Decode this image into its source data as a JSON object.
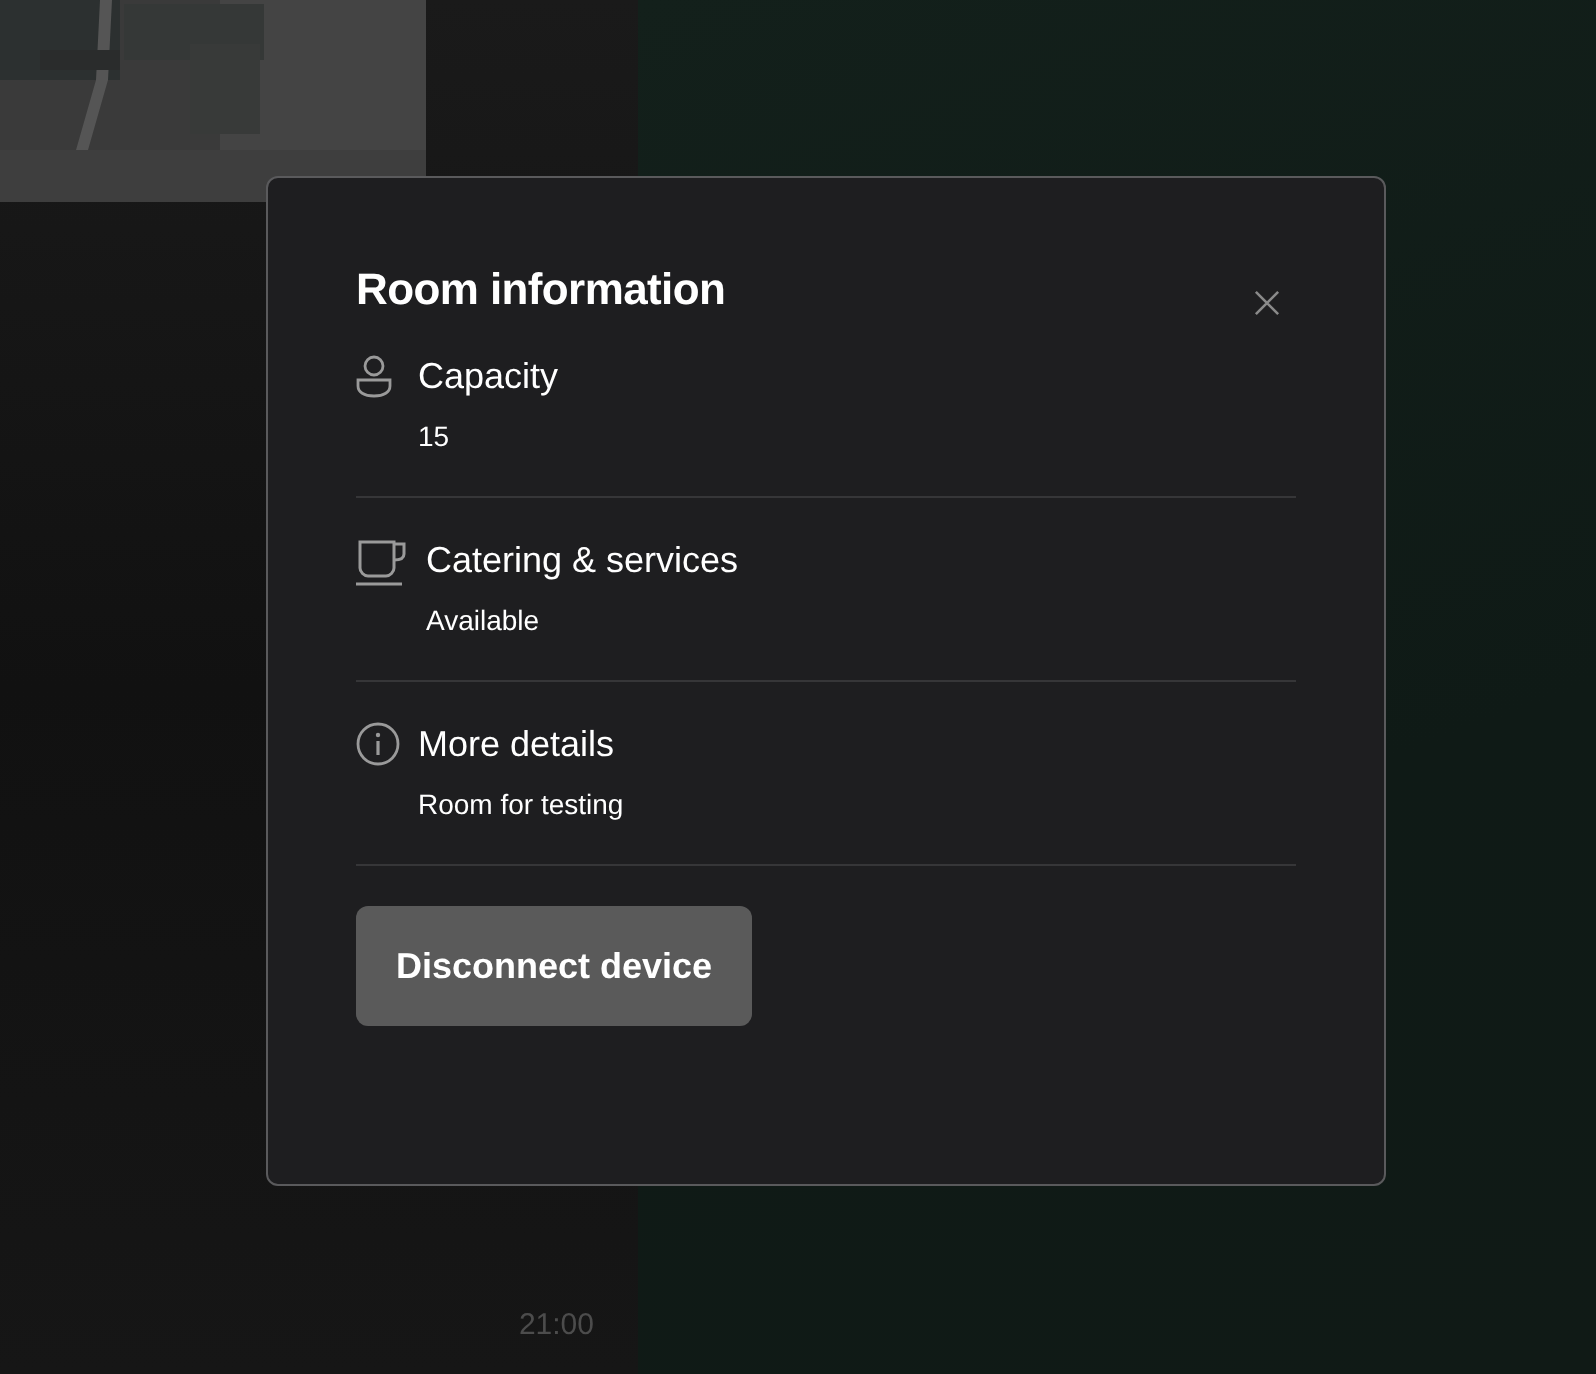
{
  "background": {
    "time": "21:00"
  },
  "dialog": {
    "title": "Room information",
    "sections": [
      {
        "kind": "capacity",
        "title": "Capacity",
        "value": "15"
      },
      {
        "kind": "catering",
        "title": "Catering & services",
        "value": "Available"
      },
      {
        "kind": "details",
        "title": "More details",
        "value": "Room for testing"
      }
    ],
    "button": "Disconnect device"
  }
}
